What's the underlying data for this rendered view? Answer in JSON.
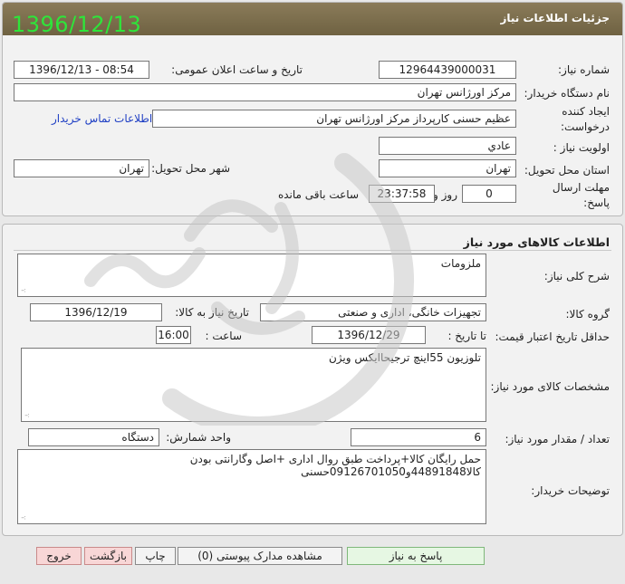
{
  "header": {
    "title": "جزئیات اطلاعات نیاز",
    "stamp_date": "1396/12/13"
  },
  "need_info": {
    "need_number_label": "شماره نیاز:",
    "need_number": "12964439000031",
    "announce_label": "تاریخ و ساعت اعلان عمومی:",
    "announce_value": "1396/12/13 - 08:54",
    "buyer_org_label": "نام دستگاه خریدار:",
    "buyer_org": "مرکز اورژانس تهران",
    "creator_label_1": "ایجاد کننده",
    "creator_label_2": "درخواست:",
    "creator": "عظیم حسنی کارپرداز مرکز اورژانس تهران",
    "contact_link": "اطلاعات تماس خریدار",
    "priority_label": "اولویت نیاز :",
    "priority": "عادي",
    "province_label": "استان محل تحویل:",
    "province": "تهران",
    "city_label": "شهر محل تحویل:",
    "city": "تهران",
    "deadline_label_1": "مهلت ارسال",
    "deadline_label_2": "پاسخ:",
    "days_value": "0",
    "days_unit": "روز و",
    "time_value": "23:37:58",
    "remaining_text": "ساعت باقی مانده"
  },
  "goods": {
    "section_title": "اطلاعات کالاهای مورد نیاز",
    "summary_label": "شرح کلی نیاز:",
    "summary": "ملزومات",
    "group_label": "گروه کالا:",
    "group": "تجهیزات خانگی، اداری و صنعتی",
    "need_date_label": "تاریخ نیاز به کالا:",
    "need_date": "1396/12/19",
    "min_price_label": "حداقل تاریخ اعتبار قیمت:",
    "to_date_label": "تا تاریخ :",
    "to_date": "1396/12/29",
    "time_label": "ساعت :",
    "time": "16:00",
    "spec_label": "مشخصات کالای مورد نیاز:",
    "spec": "تلوزیون 55اینچ ترجیحاایکس ویژن",
    "qty_label": "تعداد / مقدار مورد نیاز:",
    "qty": "6",
    "unit_label": "واحد شمارش:",
    "unit": "دستگاه",
    "buyer_notes_label": "توضیحات خریدار:",
    "buyer_notes": "حمل رایگان کالا+پرداخت طبق روال اداری +اصل وگارانتی بودن کالا44891848و09126701050حسنی"
  },
  "buttons": {
    "reply": "پاسخ به نیاز",
    "attachments": "مشاهده مدارک پیوستی (0)",
    "print": "چاپ",
    "back": "بازگشت",
    "exit": "خروج"
  }
}
